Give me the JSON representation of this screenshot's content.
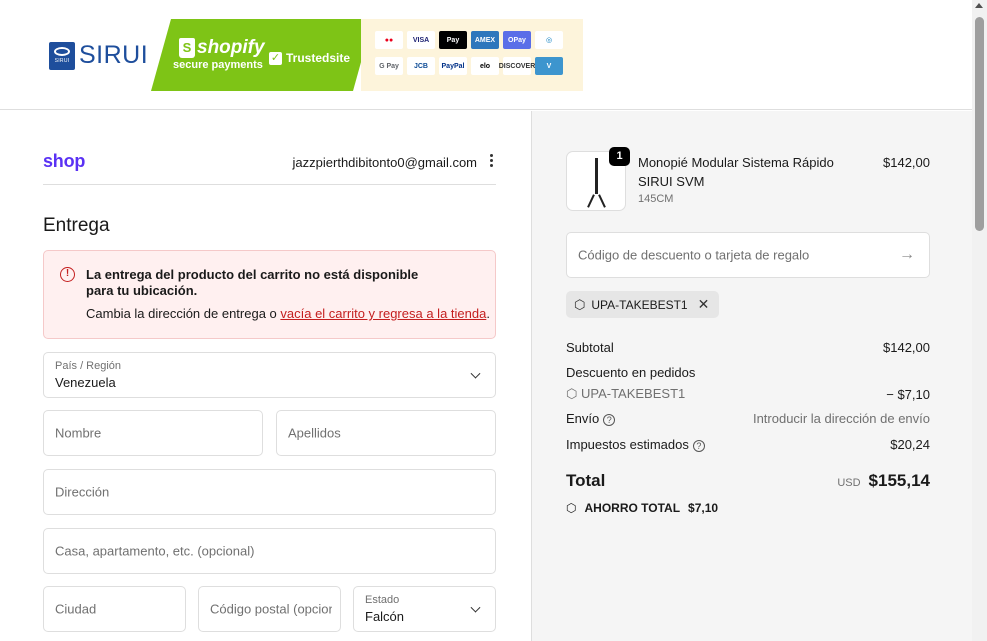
{
  "header": {
    "brand": "SIRUI",
    "brand_small": "SIRUI",
    "shopify_word": "shopify",
    "shopify_sub": "secure payments",
    "trusted": "Trustedsite",
    "payment_cards": [
      {
        "name": "mastercard",
        "label": "●●",
        "bg": "#ffffff",
        "fg": "#eb001b"
      },
      {
        "name": "visa",
        "label": "VISA",
        "bg": "#ffffff",
        "fg": "#1a1f71"
      },
      {
        "name": "apple-pay",
        "label": "Pay",
        "bg": "#000000",
        "fg": "#ffffff"
      },
      {
        "name": "amex",
        "label": "AMEX",
        "bg": "#2e77bc",
        "fg": "#ffffff"
      },
      {
        "name": "opay",
        "label": "OPay",
        "bg": "#5a6ee8",
        "fg": "#ffffff"
      },
      {
        "name": "diners",
        "label": "◎",
        "bg": "#ffffff",
        "fg": "#0079be"
      },
      {
        "name": "gpay",
        "label": "G Pay",
        "bg": "#ffffff",
        "fg": "#5f6368"
      },
      {
        "name": "jcb",
        "label": "JCB",
        "bg": "#ffffff",
        "fg": "#0e4c96"
      },
      {
        "name": "paypal",
        "label": "PayPal",
        "bg": "#ffffff",
        "fg": "#003087"
      },
      {
        "name": "elo",
        "label": "elo",
        "bg": "#ffffff",
        "fg": "#000000"
      },
      {
        "name": "discover",
        "label": "DISCOVER",
        "bg": "#ffffff",
        "fg": "#333333"
      },
      {
        "name": "venmo",
        "label": "V",
        "bg": "#3d95ce",
        "fg": "#ffffff"
      }
    ]
  },
  "checkout": {
    "shop_logo": "shop",
    "email": "jazzpierthdibitonto0@gmail.com",
    "heading": "Entrega",
    "alert": {
      "title": "La entrega del producto del carrito no está disponible para tu ubicación.",
      "msg_prefix": "Cambia la dirección de entrega o ",
      "link": "vacía el carrito y regresa a la tienda",
      "msg_suffix": "."
    },
    "country": {
      "label": "País / Región",
      "value": "Venezuela"
    },
    "first_name_ph": "Nombre",
    "last_name_ph": "Apellidos",
    "address_ph": "Dirección",
    "apt_ph": "Casa, apartamento, etc. (opcional)",
    "city_ph": "Ciudad",
    "postal_ph": "Código postal (opcional)",
    "state": {
      "label": "Estado",
      "value": "Falcón"
    }
  },
  "summary": {
    "product": {
      "qty": "1",
      "name": "Monopié Modular Sistema Rápido SIRUI SVM",
      "variant": "145CM",
      "price": "$142,00"
    },
    "discount_ph": "Código de descuento o tarjeta de regalo",
    "discount_code": "UPA-TAKEBEST1",
    "subtotal_label": "Subtotal",
    "subtotal": "$142,00",
    "order_discount_label": "Descuento en pedidos",
    "order_discount_code": "UPA-TAKEBEST1",
    "order_discount_value": "− $7,10",
    "shipping_label": "Envío",
    "shipping_value": "Introducir la dirección de envío",
    "taxes_label": "Impuestos estimados",
    "taxes_value": "$20,24",
    "total_label": "Total",
    "currency": "USD",
    "total": "$155,14",
    "savings_label": "AHORRO TOTAL",
    "savings": "$7,10"
  }
}
